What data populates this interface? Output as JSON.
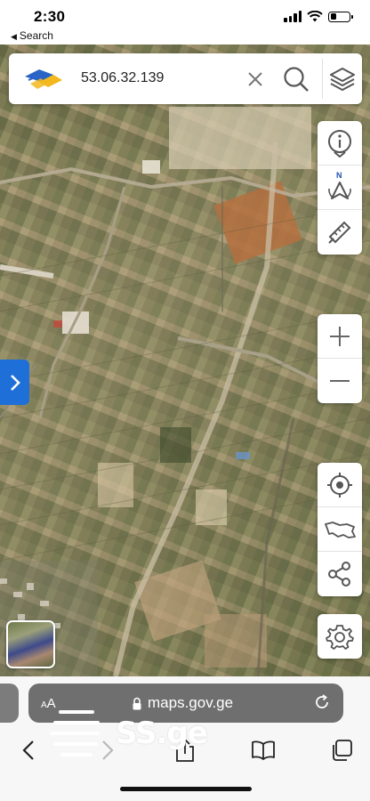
{
  "status_bar": {
    "time": "2:30",
    "back_label": "Search",
    "battery_level": 0.3
  },
  "search": {
    "value": "53.06.32.139",
    "clear_icon": "close-icon",
    "search_icon": "search-icon",
    "layers_icon": "layers-icon"
  },
  "map_tools": {
    "top_group": [
      "info-icon",
      "compass-north-icon",
      "measure-ruler-icon"
    ],
    "compass_label": "N",
    "zoom_group": [
      "zoom-in-icon",
      "zoom-out-icon"
    ],
    "location_group": [
      "locate-icon",
      "georgia-map-icon",
      "share-icon"
    ],
    "settings_icon": "gear-icon"
  },
  "sidebar_toggle_icon": "chevron-right-icon",
  "browser": {
    "aa_label_small": "A",
    "aa_label_large": "A",
    "url": "maps.gov.ge",
    "reload_icon": "reload-icon"
  },
  "toolbar": [
    "back-icon",
    "forward-icon",
    "share-icon",
    "bookmarks-icon",
    "tabs-icon"
  ],
  "watermark": "SS.ge",
  "colors": {
    "accent_blue": "#1e6fd8",
    "url_pill": "#6f6f6f"
  }
}
